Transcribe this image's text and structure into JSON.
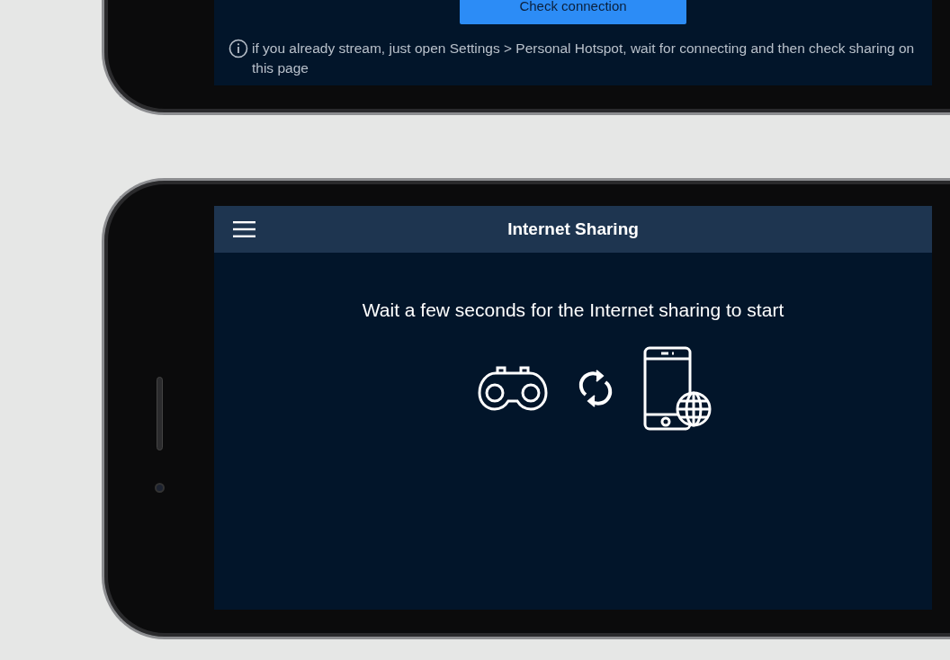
{
  "top_screen": {
    "button": "Check connection",
    "note": "if you already stream, just open Settings > Personal Hotspot, wait for connecting and then check sharing on this page"
  },
  "bottom_screen": {
    "title": "Internet Sharing",
    "message": "Wait a few seconds for the Internet sharing to start"
  }
}
